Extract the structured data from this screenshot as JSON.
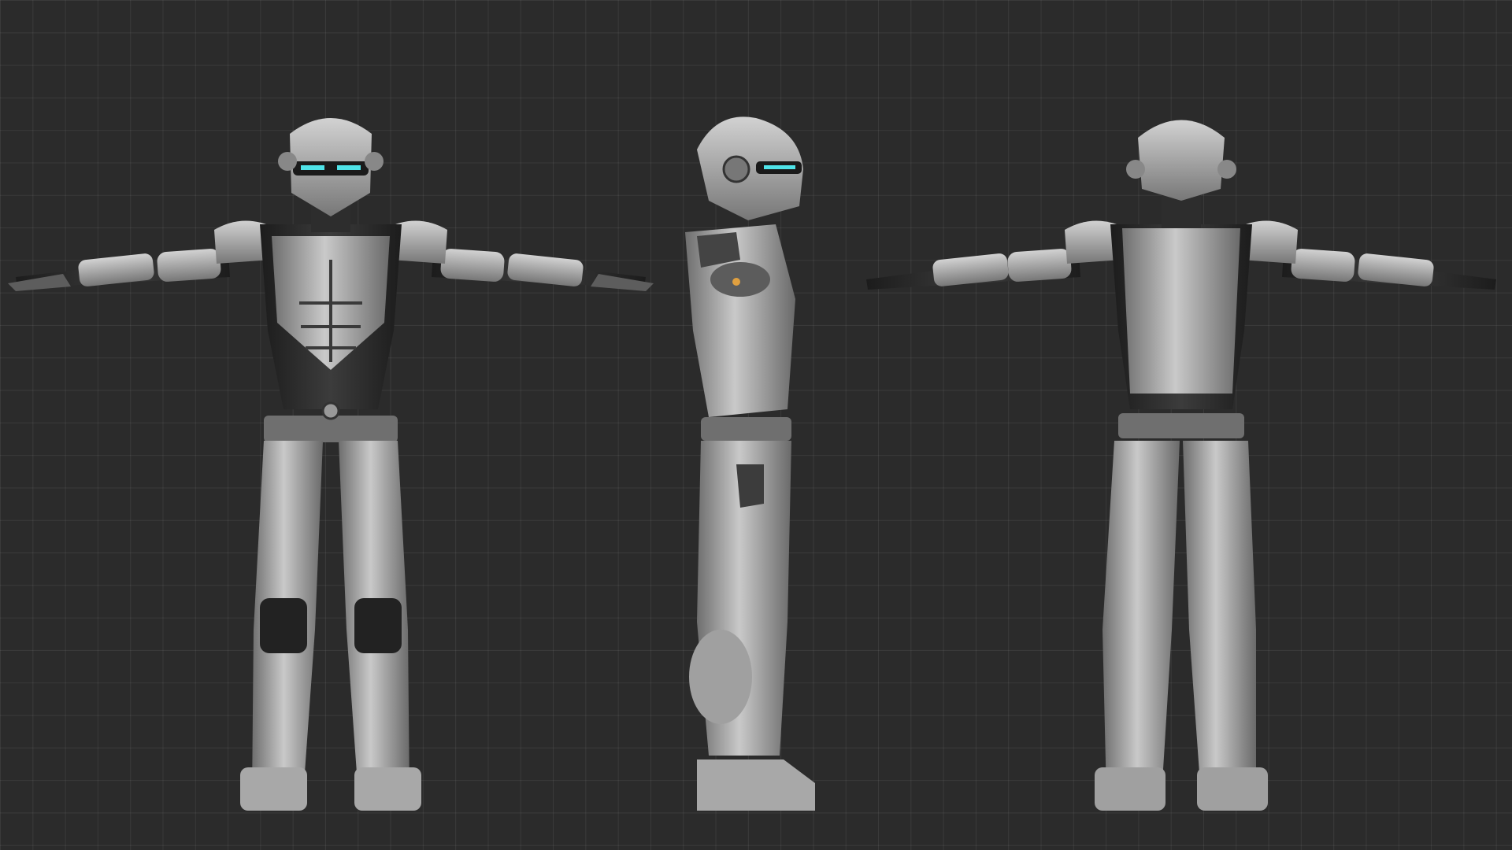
{
  "scene": {
    "type": "character turnaround",
    "views": [
      "front",
      "side",
      "back"
    ],
    "colors": {
      "background": "#2b2b2b",
      "grid": "#3a3a3a",
      "armor_light": "#b9b9b9",
      "armor_mid": "#7d7d7d",
      "undersuit": "#2a2a2a",
      "visor_glow": "#4fe3e8"
    }
  }
}
